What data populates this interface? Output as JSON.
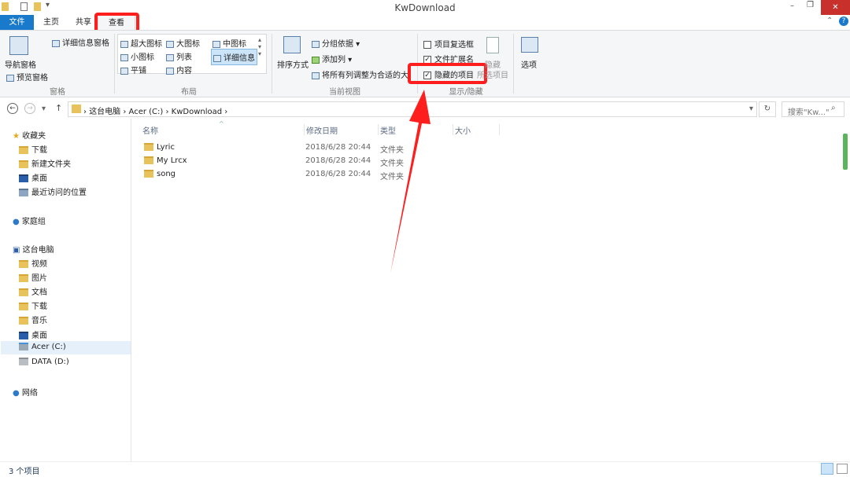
{
  "window": {
    "title": "KwDownload"
  },
  "tabs": [
    "文件",
    "主页",
    "共享",
    "查看"
  ],
  "ribbon": {
    "pane": {
      "nav": "导航窗格",
      "preview": "预览窗格",
      "details": "详细信息窗格",
      "group": "窗格"
    },
    "layout": {
      "items": [
        "超大图标",
        "大图标",
        "中图标",
        "小图标",
        "列表",
        "详细信息",
        "平铺",
        "内容"
      ],
      "group": "布局"
    },
    "current_view": {
      "sort": "排序方式",
      "group_by": "分组依据",
      "add_column": "添加列",
      "fit_columns": "将所有列调整为合适的大小",
      "group": "当前视图"
    },
    "show_hide": {
      "checkboxes": "项目复选框",
      "extensions": "文件扩展名",
      "hidden": "隐藏的项目",
      "hide_selected": "隐藏",
      "hide_selected2": "所选项目",
      "group": "显示/隐藏"
    },
    "options": "选项"
  },
  "address": {
    "parts": [
      "这台电脑",
      "Acer (C:)",
      "KwDownload"
    ],
    "search_placeholder": "搜索\"Kw...\""
  },
  "nav": {
    "favorites": "收藏夹",
    "fav_items": [
      "下载",
      "新建文件夹",
      "桌面",
      "最近访问的位置"
    ],
    "homegroup": "家庭组",
    "pc": "这台电脑",
    "pc_items": [
      "视频",
      "图片",
      "文档",
      "下载",
      "音乐",
      "桌面",
      "Acer (C:)",
      "DATA (D:)"
    ],
    "network": "网络"
  },
  "columns": {
    "name": "名称",
    "date": "修改日期",
    "type": "类型",
    "size": "大小"
  },
  "files": [
    {
      "name": "Lyric",
      "date": "2018/6/28 20:44",
      "type": "文件夹"
    },
    {
      "name": "My Lrcx",
      "date": "2018/6/28 20:44",
      "type": "文件夹"
    },
    {
      "name": "song",
      "date": "2018/6/28 20:44",
      "type": "文件夹"
    }
  ],
  "status": "3 个项目",
  "colors": {
    "accent": "#1979ca",
    "highlight": "#ff1e1e"
  }
}
